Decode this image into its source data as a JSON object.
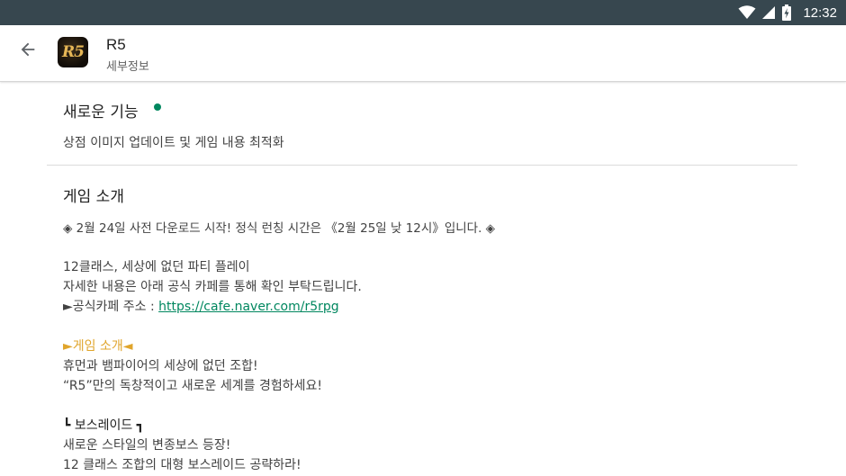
{
  "status_bar": {
    "time": "12:32"
  },
  "app_bar": {
    "title": "R5",
    "subtitle": "세부정보",
    "icon_text": "R5"
  },
  "whats_new": {
    "title": "새로운 기능",
    "text": "상점 이미지 업데이트 및 게임 내용 최적화"
  },
  "about": {
    "title": "게임 소개",
    "line1": "◈ 2월 24일 사전 다운로드 시작! 정식 런칭 시간은 《2월 25일 낮 12시》입니다. ◈",
    "line2": "12클래스, 세상에 없던 파티 플레이",
    "line3": "자세한 내용은 아래 공식 카페를 통해 확인 부탁드립니다.",
    "line4_prefix": "►공식카페 주소 : ",
    "cafe_url": "https://cafe.naver.com/r5rpg",
    "intro_heading": "►게임 소개◄",
    "intro_line1": "휴먼과 뱀파이어의 세상에 없던 조합!",
    "intro_line2": "“R5”만의 독창적이고 새로운 세계를 경험하세요!",
    "raid_heading": "┗ 보스레이드 ┓",
    "raid_line1": "새로운 스타일의 변종보스 등장!",
    "raid_line2": "12 클래스 조합의 대형 보스레이드 공략하라!"
  }
}
